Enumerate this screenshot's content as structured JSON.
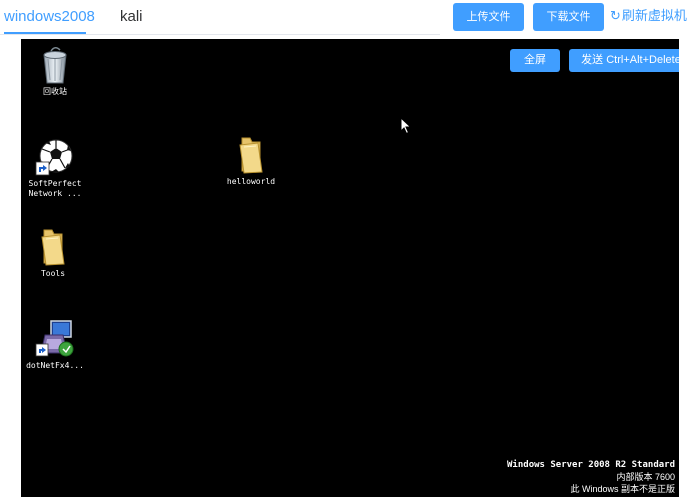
{
  "tabs": [
    {
      "label": "windows2008",
      "active": true
    },
    {
      "label": "kali",
      "active": false
    }
  ],
  "toolbar": {
    "upload_label": "上传文件",
    "download_label": "下载文件",
    "refresh_label": "刷新虚拟机",
    "refresh_icon": "refresh-icon"
  },
  "vm": {
    "fullscreen_label": "全屏",
    "send_cad_label": "发送 Ctrl+Alt+Delete",
    "desktop_icons": [
      {
        "label": "回收站",
        "icon": "recycle-bin-icon"
      },
      {
        "label": "SoftPerfect\nNetwork ...",
        "icon": "soccer-ball-shortcut-icon"
      },
      {
        "label": "helloworld",
        "icon": "folder-icon"
      },
      {
        "label": "Tools",
        "icon": "folder-icon"
      },
      {
        "label": "dotNetFx4...",
        "icon": "installer-shortcut-icon"
      }
    ],
    "watermark": {
      "line1": "Windows Server 2008 R2 Standard",
      "line2": "内部版本 7600",
      "line3": "此 Windows 副本不是正版"
    }
  },
  "colors": {
    "accent": "#409eff",
    "vm_background": "#000000"
  }
}
